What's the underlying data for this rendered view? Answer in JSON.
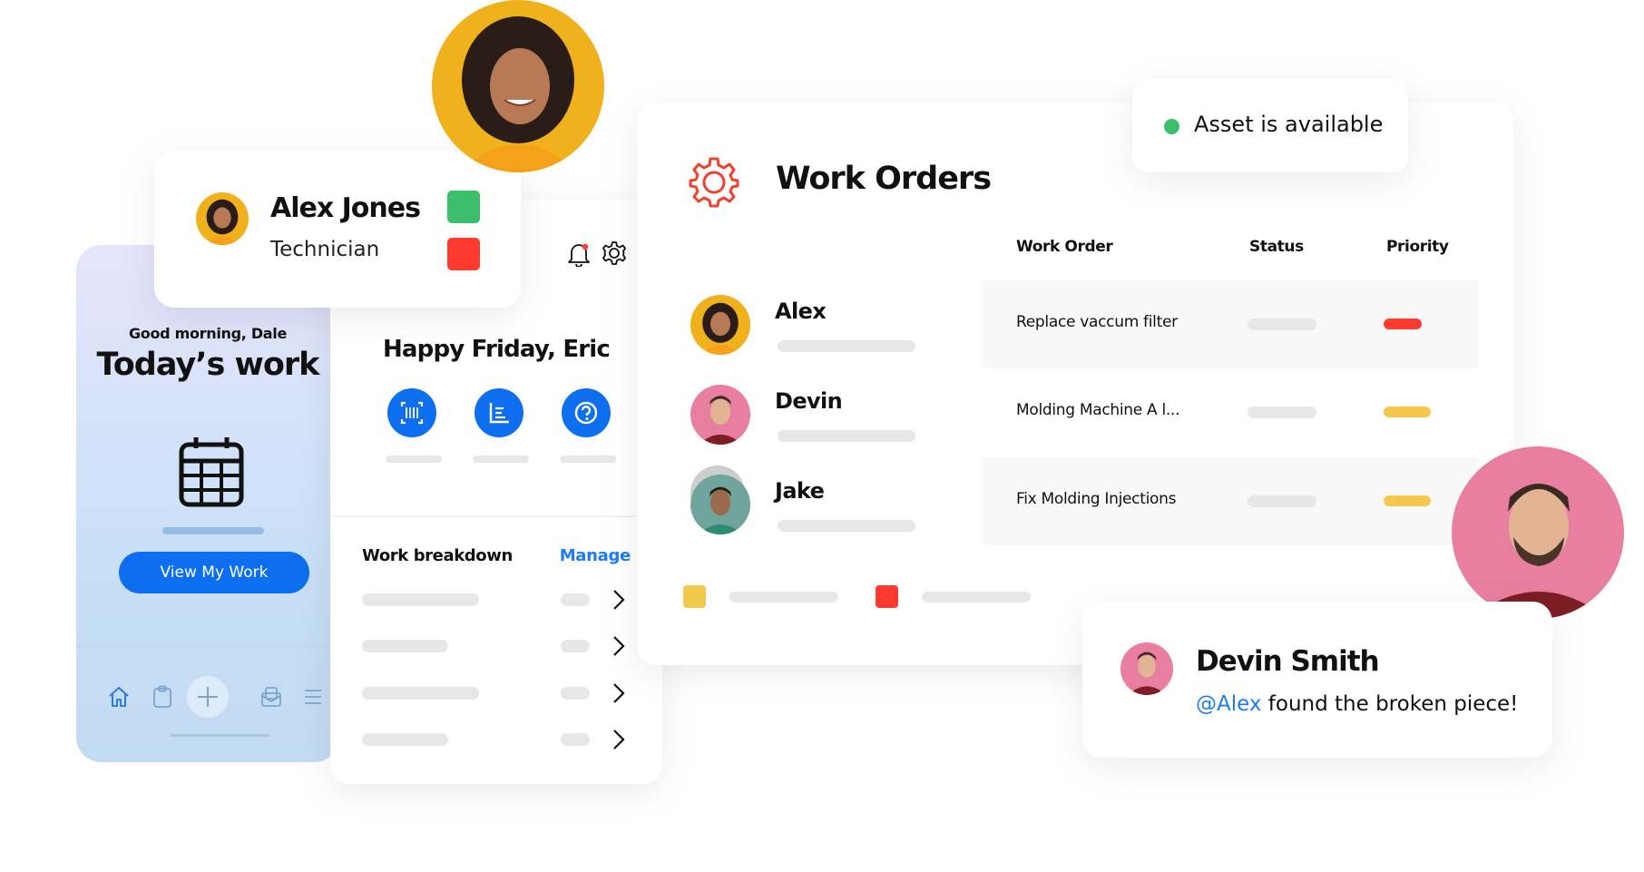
{
  "profile_card": {
    "name": "Alex Jones",
    "role": "Technician",
    "status_colors": [
      "#3cbf6a",
      "#ff3b2f"
    ]
  },
  "phone": {
    "greeting": "Good morning, Dale",
    "title": "Today’s work",
    "icon": "calendar-icon",
    "button_label": "View My Work",
    "accent": "#0d6ef0",
    "tabbar": [
      "home-icon",
      "clipboard-icon",
      "add-icon",
      "inbox-icon",
      "menu-icon"
    ]
  },
  "mobile_panel": {
    "header_icons": [
      "bell-icon",
      "gear-icon"
    ],
    "greeting": "Happy Friday, Eric",
    "quick_actions": [
      "barcode-scan-icon",
      "report-chart-icon",
      "help-icon"
    ],
    "section_title": "Work breakdown",
    "section_action": "Manage",
    "breakdown_rows": 4
  },
  "work_orders": {
    "title": "Work Orders",
    "icon": "gear-icon",
    "accent": "#f0412f",
    "columns": [
      "Work Order",
      "Status",
      "Priority"
    ],
    "assignees": [
      {
        "name": "Alex"
      },
      {
        "name": "Devin"
      },
      {
        "name": "Jake"
      }
    ],
    "rows": [
      {
        "work_order": "Replace vaccum filter",
        "priority_color": "#ff3b2f"
      },
      {
        "work_order": "Molding Machine A l...",
        "priority_color": "#f5c74c"
      },
      {
        "work_order": "Fix Molding Injections",
        "priority_color": "#f5c74c"
      }
    ],
    "legend_colors": [
      "#f2c94c",
      "#ff3b2f"
    ]
  },
  "asset_badge": {
    "text": "Asset is available",
    "dot_color": "#3cbf6a"
  },
  "comment": {
    "author": "Devin Smith",
    "mention": "@Alex",
    "message": " found the broken piece!",
    "mention_color": "#1e7cf2"
  }
}
